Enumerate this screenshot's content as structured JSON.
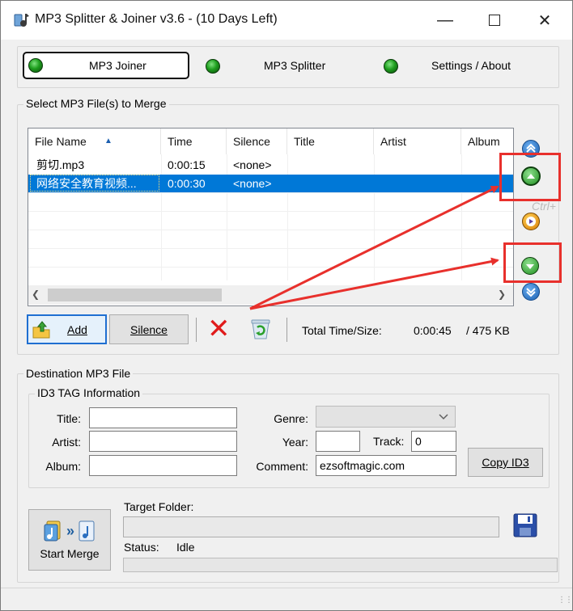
{
  "window": {
    "title": "MP3 Splitter & Joiner v3.6 - (10 Days Left)"
  },
  "tabs": [
    "MP3 Joiner",
    "MP3 Splitter",
    "Settings / About"
  ],
  "merge_group": {
    "label": "Select MP3 File(s) to Merge"
  },
  "file_list": {
    "columns": [
      "File Name",
      "Time",
      "Silence",
      "Title",
      "Artist",
      "Album"
    ],
    "rows": [
      {
        "name": "剪切.mp3",
        "time": "0:00:15",
        "silence": "<none>"
      },
      {
        "name": "网络安全教育视频...",
        "time": "0:00:30",
        "silence": "<none>"
      }
    ]
  },
  "side_text": "Ctrl+",
  "toolbar": {
    "add": "Add",
    "silence": "Silence",
    "total_label": "Total Time/Size:",
    "total_time": "0:00:45",
    "total_size": "/ 475 KB"
  },
  "destination": {
    "label": "Destination MP3 File",
    "id3_label": "ID3 TAG Information",
    "title_label": "Title:",
    "artist_label": "Artist:",
    "album_label": "Album:",
    "genre_label": "Genre:",
    "year_label": "Year:",
    "track_label": "Track:",
    "track_value": "0",
    "comment_label": "Comment:",
    "comment_value": "ezsoftmagic.com",
    "copy_id3": "Copy ID3"
  },
  "merge": {
    "start": "Start Merge",
    "target_folder_label": "Target Folder:",
    "status_label": "Status:",
    "status_value": "Idle"
  },
  "colors": {
    "selection": "#0078d7",
    "accent_red": "#e8302c",
    "led_green": "#1e9e1e"
  }
}
